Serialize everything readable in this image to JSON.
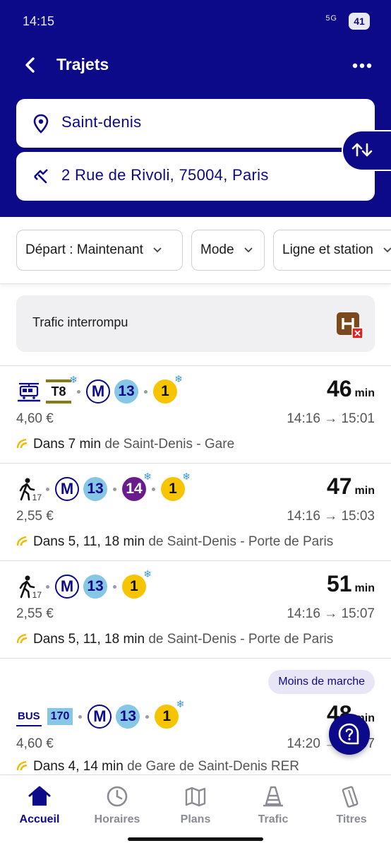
{
  "status_bar": {
    "time": "14:15",
    "signal": "5G",
    "battery": "41"
  },
  "header": {
    "title": "Trajets",
    "back_icon": "chevron-left-icon",
    "menu_icon": "more-horizontal-icon"
  },
  "search": {
    "origin": "Saint-denis",
    "destination": "2 Rue de Rivoli, 75004, Paris",
    "swap_icon": "swap-vertical-icon"
  },
  "filters": [
    {
      "label": "Départ : Maintenant"
    },
    {
      "label": "Mode"
    },
    {
      "label": "Ligne et station"
    }
  ],
  "alert": {
    "text": "Trafic interrompu",
    "icon": "elevator-out-icon"
  },
  "routes": [
    {
      "duration": "46",
      "unit": "min",
      "price": "4,60 €",
      "depart": "14:16",
      "arrive": "15:01",
      "next": "Dans 7 min",
      "from": "de Saint-Denis - Gare",
      "lines": [
        "tram",
        "T8",
        "M",
        "13",
        "1"
      ]
    },
    {
      "duration": "47",
      "unit": "min",
      "price": "2,55 €",
      "depart": "14:16",
      "arrive": "15:03",
      "next": "Dans 5, 11, 18 min",
      "from": "de Saint-Denis - Porte de Paris",
      "walk": "17",
      "lines": [
        "walk",
        "M",
        "13",
        "14",
        "1"
      ]
    },
    {
      "duration": "51",
      "unit": "min",
      "price": "2,55 €",
      "depart": "14:16",
      "arrive": "15:07",
      "next": "Dans 5, 11, 18 min",
      "from": "de Saint-Denis - Porte de Paris",
      "walk": "17",
      "lines": [
        "walk",
        "M",
        "13",
        "1"
      ]
    },
    {
      "tag": "Moins de marche",
      "duration": "48",
      "unit": "min",
      "price": "4,60 €",
      "depart": "14:20",
      "arrive": "15:07",
      "next": "Dans 4, 14 min",
      "from": "de Gare de Saint-Denis RER",
      "bus_label": "BUS",
      "bus_line": "170",
      "lines": [
        "bus",
        "170",
        "M",
        "13",
        "1"
      ]
    }
  ],
  "line_badges": {
    "metro": "M",
    "l13": "13",
    "l14": "14",
    "l1": "1",
    "t8": "T8"
  },
  "arrow": "→",
  "nav": [
    {
      "label": "Accueil",
      "icon": "home-icon",
      "active": true
    },
    {
      "label": "Horaires",
      "icon": "clock-icon",
      "active": false
    },
    {
      "label": "Plans",
      "icon": "map-icon",
      "active": false
    },
    {
      "label": "Trafic",
      "icon": "traffic-cone-icon",
      "active": false
    },
    {
      "label": "Titres",
      "icon": "ticket-icon",
      "active": false
    }
  ],
  "colors": {
    "brand": "#0d0a8a",
    "line13": "#86c7e6",
    "line14": "#6a1b8c",
    "line1": "#f7c500",
    "t8": "#8a7a12"
  }
}
